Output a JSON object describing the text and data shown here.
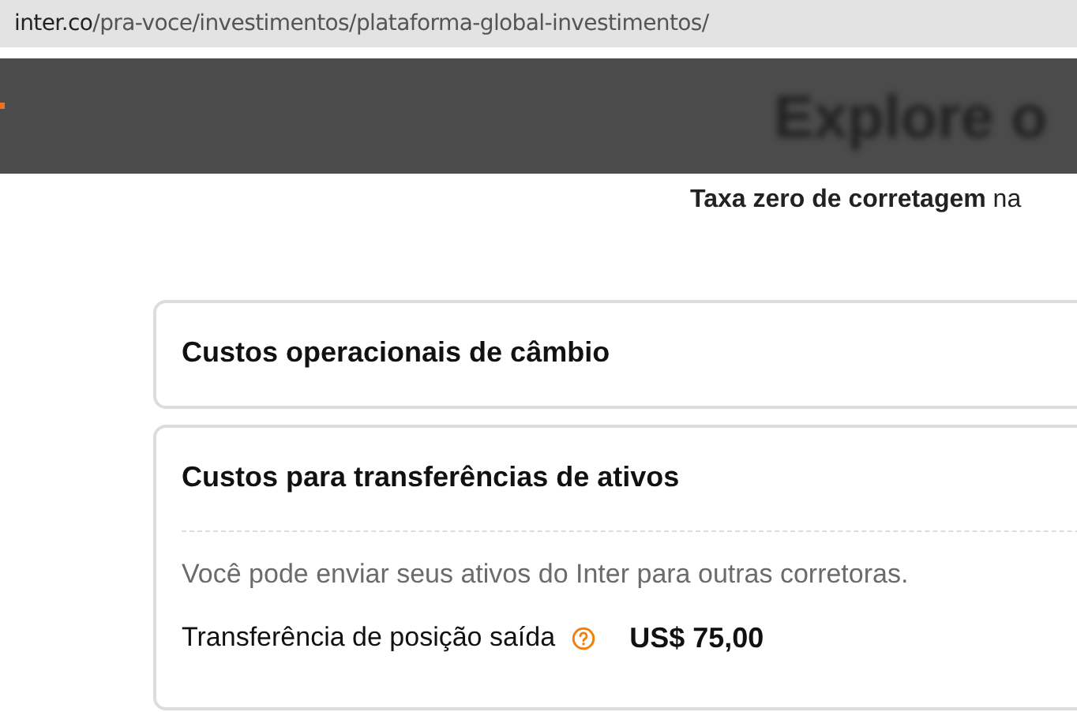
{
  "address_bar": {
    "domain": "inter.co",
    "path": "/pra-voce/investimentos/plataforma-global-investimentos/"
  },
  "banner": {
    "heading": "Explore o"
  },
  "subtitle": "**Taxa zero de corretagem** na",
  "sections": [
    {
      "title": "Custos operacionais de câmbio",
      "expanded": false
    },
    {
      "title": "Custos para transferências de ativos",
      "expanded": true,
      "description": "Você pode enviar seus ativos do Inter para outras corretoras.",
      "fees": [
        {
          "label": "Transferência de posição saída",
          "value": "US$ 75,00"
        }
      ]
    }
  ]
}
